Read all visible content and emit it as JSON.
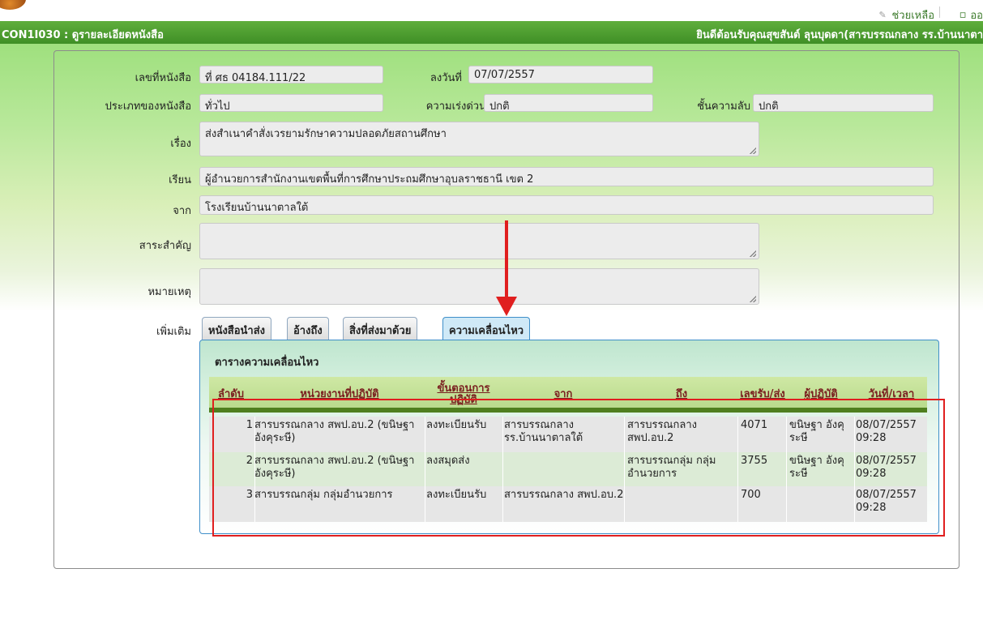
{
  "header": {
    "help": "ช่วยเหลือ",
    "exit": "ออ"
  },
  "title_bar": {
    "code_title": "CON1I030 : ดูรายละเอียดหนังสือ",
    "welcome": "ยินดีต้อนรับคุณสุขสันต์ ลุนบุดดา(สารบรรณกลาง รร.บ้านนาตา"
  },
  "form": {
    "doc_no_label": "เลขที่หนังสือ",
    "doc_no": "ที่ ศธ 04184.111/22",
    "date_label": "ลงวันที่",
    "date": "07/07/2557",
    "type_label": "ประเภทของหนังสือ",
    "type": "ทั่วไป",
    "urgency_label": "ความเร่งด่วน",
    "urgency": "ปกติ",
    "secrecy_label": "ชั้นความลับ",
    "secrecy": "ปกติ",
    "subject_label": "เรื่อง",
    "subject": "ส่งสำเนาคำสั่งเวรยามรักษาความปลอดภัยสถานศึกษา",
    "to_label": "เรียน",
    "to": "ผู้อำนวยการสำนักงานเขตพื้นที่การศึกษาประถมศึกษาอุบลราชธานี เขต 2",
    "from_label": "จาก",
    "from": "โรงเรียนบ้านนาตาลใต้",
    "summary_label": "สาระสำคัญ",
    "summary": "",
    "note_label": "หมายเหตุ",
    "note": "",
    "more_label": "เพิ่มเติม"
  },
  "tabs": [
    {
      "label": "หนังสือนำส่ง"
    },
    {
      "label": "อ้างถึง"
    },
    {
      "label": "สิ่งที่ส่งมาด้วย"
    },
    {
      "label": "ความเคลื่อนไหว"
    }
  ],
  "movement": {
    "caption": "ตารางความเคลื่อนไหว",
    "columns": [
      "ลำดับ",
      "หน่วยงานที่ปฏิบัติ",
      "ขั้นตอนการปฏิบัติ",
      "จาก",
      "ถึง",
      "เลขรับ/ส่ง",
      "ผู้ปฏิบัติ",
      "วันที่/เวลา"
    ],
    "rows": [
      {
        "no": "1",
        "unit": "สารบรรณกลาง สพป.อบ.2 (ขนิษฐา อังคุระษี)",
        "step": "ลงทะเบียนรับ",
        "from": "สารบรรณกลาง รร.บ้านนาตาลใต้",
        "to": "สารบรรณกลาง สพป.อบ.2",
        "num": "4071",
        "actor": "ขนิษฐา อังคุระษี",
        "datetime": "08/07/2557 09:28"
      },
      {
        "no": "2",
        "unit": "สารบรรณกลาง สพป.อบ.2 (ขนิษฐา อังคุระษี)",
        "step": "ลงสมุดส่ง",
        "from": "",
        "to": "สารบรรณกลุ่ม กลุ่มอำนวยการ",
        "num": "3755",
        "actor": "ขนิษฐา อังคุระษี",
        "datetime": "08/07/2557 09:28"
      },
      {
        "no": "3",
        "unit": "สารบรรณกลุ่ม กลุ่มอำนวยการ",
        "step": "ลงทะเบียนรับ",
        "from": "สารบรรณกลาง สพป.อบ.2",
        "to": "",
        "num": "700",
        "actor": "",
        "datetime": "08/07/2557 09:28"
      }
    ]
  },
  "colors": {
    "title_green": "#4a9a2e",
    "annotation_red": "#e01f1f",
    "tab_border": "#3f8fc9",
    "header_text": "#7a2020"
  }
}
